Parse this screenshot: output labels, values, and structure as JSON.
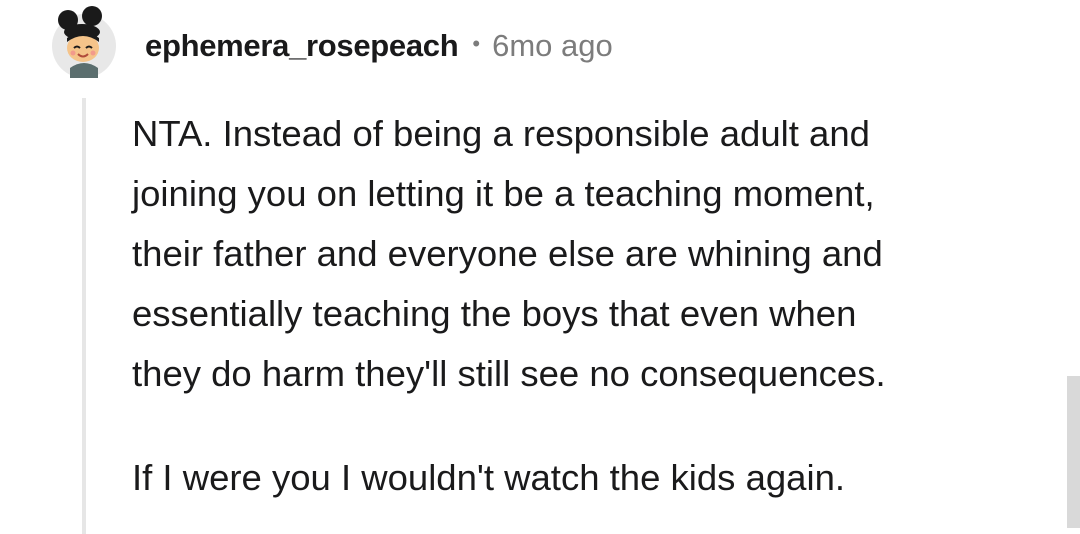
{
  "comment": {
    "username": "ephemera_rosepeach",
    "separator": "•",
    "timestamp": "6mo ago",
    "paragraphs": [
      "NTA. Instead of being a responsible adult and\njoining you on letting it be a teaching moment,\ntheir father and everyone else are whining and\nessentially teaching the boys that even when\nthey do harm they'll still see no consequences.",
      "If I were you I wouldn't watch the kids again."
    ],
    "avatar": {
      "icon": "snoo-avatar-icon",
      "colors": {
        "background": "#e8e8e8",
        "hair": "#1a1a1a",
        "face": "#f5c48a",
        "shirt": "#5b6e6e"
      }
    }
  },
  "colors": {
    "text": "#1a1a1b",
    "meta": "#7c7c7c",
    "thread_line": "#e6e6e6"
  }
}
